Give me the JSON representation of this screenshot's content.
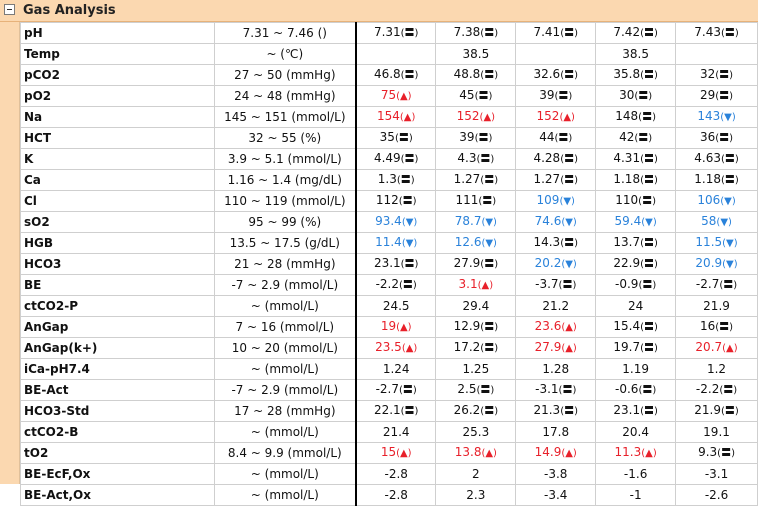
{
  "header": {
    "title": "Gas Analysis",
    "toggle": "minus-box"
  },
  "colors": {
    "header_bg": "#fbd8b0",
    "normal": "#111111",
    "high": "#e8202a",
    "low": "#2a82da"
  },
  "rows": [
    {
      "name": "pH",
      "range": "7.31 ~ 7.46 ()",
      "values": [
        {
          "v": "7.31",
          "f": "N"
        },
        {
          "v": "7.38",
          "f": "N"
        },
        {
          "v": "7.41",
          "f": "N"
        },
        {
          "v": "7.42",
          "f": "N"
        },
        {
          "v": "7.43",
          "f": "N"
        }
      ]
    },
    {
      "name": "Temp",
      "range": "~ (℃)",
      "values": [
        {
          "v": "",
          "f": ""
        },
        {
          "v": "38.5",
          "f": ""
        },
        {
          "v": "",
          "f": ""
        },
        {
          "v": "38.5",
          "f": ""
        },
        {
          "v": "",
          "f": ""
        }
      ]
    },
    {
      "name": "pCO2",
      "range": "27 ~ 50 (mmHg)",
      "values": [
        {
          "v": "46.8",
          "f": "N"
        },
        {
          "v": "48.8",
          "f": "N"
        },
        {
          "v": "32.6",
          "f": "N"
        },
        {
          "v": "35.8",
          "f": "N"
        },
        {
          "v": "32",
          "f": "N"
        }
      ]
    },
    {
      "name": "pO2",
      "range": "24 ~ 48 (mmHg)",
      "values": [
        {
          "v": "75",
          "f": "H"
        },
        {
          "v": "45",
          "f": "N"
        },
        {
          "v": "39",
          "f": "N"
        },
        {
          "v": "30",
          "f": "N"
        },
        {
          "v": "29",
          "f": "N"
        }
      ]
    },
    {
      "name": "Na",
      "range": "145 ~ 151 (mmol/L)",
      "values": [
        {
          "v": "154",
          "f": "H"
        },
        {
          "v": "152",
          "f": "H"
        },
        {
          "v": "152",
          "f": "H"
        },
        {
          "v": "148",
          "f": "N"
        },
        {
          "v": "143",
          "f": "L"
        }
      ]
    },
    {
      "name": "HCT",
      "range": "32 ~ 55 (%)",
      "values": [
        {
          "v": "35",
          "f": "N"
        },
        {
          "v": "39",
          "f": "N"
        },
        {
          "v": "44",
          "f": "N"
        },
        {
          "v": "42",
          "f": "N"
        },
        {
          "v": "36",
          "f": "N"
        }
      ]
    },
    {
      "name": "K",
      "range": "3.9 ~ 5.1 (mmol/L)",
      "values": [
        {
          "v": "4.49",
          "f": "N"
        },
        {
          "v": "4.3",
          "f": "N"
        },
        {
          "v": "4.28",
          "f": "N"
        },
        {
          "v": "4.31",
          "f": "N"
        },
        {
          "v": "4.63",
          "f": "N"
        }
      ]
    },
    {
      "name": "Ca",
      "range": "1.16 ~ 1.4 (mg/dL)",
      "values": [
        {
          "v": "1.3",
          "f": "N"
        },
        {
          "v": "1.27",
          "f": "N"
        },
        {
          "v": "1.27",
          "f": "N"
        },
        {
          "v": "1.18",
          "f": "N"
        },
        {
          "v": "1.18",
          "f": "N"
        }
      ]
    },
    {
      "name": "Cl",
      "range": "110 ~ 119 (mmol/L)",
      "values": [
        {
          "v": "112",
          "f": "N"
        },
        {
          "v": "111",
          "f": "N"
        },
        {
          "v": "109",
          "f": "L"
        },
        {
          "v": "110",
          "f": "N"
        },
        {
          "v": "106",
          "f": "L"
        }
      ]
    },
    {
      "name": "sO2",
      "range": "95 ~ 99 (%)",
      "values": [
        {
          "v": "93.4",
          "f": "L"
        },
        {
          "v": "78.7",
          "f": "L"
        },
        {
          "v": "74.6",
          "f": "L"
        },
        {
          "v": "59.4",
          "f": "L"
        },
        {
          "v": "58",
          "f": "L"
        }
      ]
    },
    {
      "name": "HGB",
      "range": "13.5 ~ 17.5 (g/dL)",
      "values": [
        {
          "v": "11.4",
          "f": "L"
        },
        {
          "v": "12.6",
          "f": "L"
        },
        {
          "v": "14.3",
          "f": "N"
        },
        {
          "v": "13.7",
          "f": "N"
        },
        {
          "v": "11.5",
          "f": "L"
        }
      ]
    },
    {
      "name": "HCO3",
      "range": "21 ~ 28 (mmHg)",
      "values": [
        {
          "v": "23.1",
          "f": "N"
        },
        {
          "v": "27.9",
          "f": "N"
        },
        {
          "v": "20.2",
          "f": "L"
        },
        {
          "v": "22.9",
          "f": "N"
        },
        {
          "v": "20.9",
          "f": "L"
        }
      ]
    },
    {
      "name": "BE",
      "range": "-7 ~ 2.9 (mmol/L)",
      "values": [
        {
          "v": "-2.2",
          "f": "N"
        },
        {
          "v": "3.1",
          "f": "H"
        },
        {
          "v": "-3.7",
          "f": "N"
        },
        {
          "v": "-0.9",
          "f": "N"
        },
        {
          "v": "-2.7",
          "f": "N"
        }
      ]
    },
    {
      "name": "ctCO2-P",
      "range": "~ (mmol/L)",
      "values": [
        {
          "v": "24.5",
          "f": ""
        },
        {
          "v": "29.4",
          "f": ""
        },
        {
          "v": "21.2",
          "f": ""
        },
        {
          "v": "24",
          "f": ""
        },
        {
          "v": "21.9",
          "f": ""
        }
      ]
    },
    {
      "name": "AnGap",
      "range": "7 ~ 16 (mmol/L)",
      "values": [
        {
          "v": "19",
          "f": "H"
        },
        {
          "v": "12.9",
          "f": "N"
        },
        {
          "v": "23.6",
          "f": "H"
        },
        {
          "v": "15.4",
          "f": "N"
        },
        {
          "v": "16",
          "f": "N"
        }
      ]
    },
    {
      "name": "AnGap(k+)",
      "range": "10 ~ 20 (mmol/L)",
      "values": [
        {
          "v": "23.5",
          "f": "H"
        },
        {
          "v": "17.2",
          "f": "N"
        },
        {
          "v": "27.9",
          "f": "H"
        },
        {
          "v": "19.7",
          "f": "N"
        },
        {
          "v": "20.7",
          "f": "H"
        }
      ]
    },
    {
      "name": "iCa-pH7.4",
      "range": "~ (mmol/L)",
      "values": [
        {
          "v": "1.24",
          "f": ""
        },
        {
          "v": "1.25",
          "f": ""
        },
        {
          "v": "1.28",
          "f": ""
        },
        {
          "v": "1.19",
          "f": ""
        },
        {
          "v": "1.2",
          "f": ""
        }
      ]
    },
    {
      "name": "BE-Act",
      "range": "-7 ~ 2.9 (mmol/L)",
      "values": [
        {
          "v": "-2.7",
          "f": "N"
        },
        {
          "v": "2.5",
          "f": "N"
        },
        {
          "v": "-3.1",
          "f": "N"
        },
        {
          "v": "-0.6",
          "f": "N"
        },
        {
          "v": "-2.2",
          "f": "N"
        }
      ]
    },
    {
      "name": "HCO3-Std",
      "range": "17 ~ 28 (mmHg)",
      "values": [
        {
          "v": "22.1",
          "f": "N"
        },
        {
          "v": "26.2",
          "f": "N"
        },
        {
          "v": "21.3",
          "f": "N"
        },
        {
          "v": "23.1",
          "f": "N"
        },
        {
          "v": "21.9",
          "f": "N"
        }
      ]
    },
    {
      "name": "ctCO2-B",
      "range": "~ (mmol/L)",
      "values": [
        {
          "v": "21.4",
          "f": ""
        },
        {
          "v": "25.3",
          "f": ""
        },
        {
          "v": "17.8",
          "f": ""
        },
        {
          "v": "20.4",
          "f": ""
        },
        {
          "v": "19.1",
          "f": ""
        }
      ]
    },
    {
      "name": "tO2",
      "range": "8.4 ~ 9.9 (mmol/L)",
      "values": [
        {
          "v": "15",
          "f": "H"
        },
        {
          "v": "13.8",
          "f": "H"
        },
        {
          "v": "14.9",
          "f": "H"
        },
        {
          "v": "11.3",
          "f": "H"
        },
        {
          "v": "9.3",
          "f": "N"
        }
      ]
    },
    {
      "name": "BE-EcF,Ox",
      "range": "~ (mmol/L)",
      "values": [
        {
          "v": "-2.8",
          "f": ""
        },
        {
          "v": "2",
          "f": ""
        },
        {
          "v": "-3.8",
          "f": ""
        },
        {
          "v": "-1.6",
          "f": ""
        },
        {
          "v": "-3.1",
          "f": ""
        }
      ]
    },
    {
      "name": "BE-Act,Ox",
      "range": "~ (mmol/L)",
      "values": [
        {
          "v": "-2.8",
          "f": ""
        },
        {
          "v": "2.3",
          "f": ""
        },
        {
          "v": "-3.4",
          "f": ""
        },
        {
          "v": "-1",
          "f": ""
        },
        {
          "v": "-2.6",
          "f": ""
        }
      ]
    }
  ]
}
